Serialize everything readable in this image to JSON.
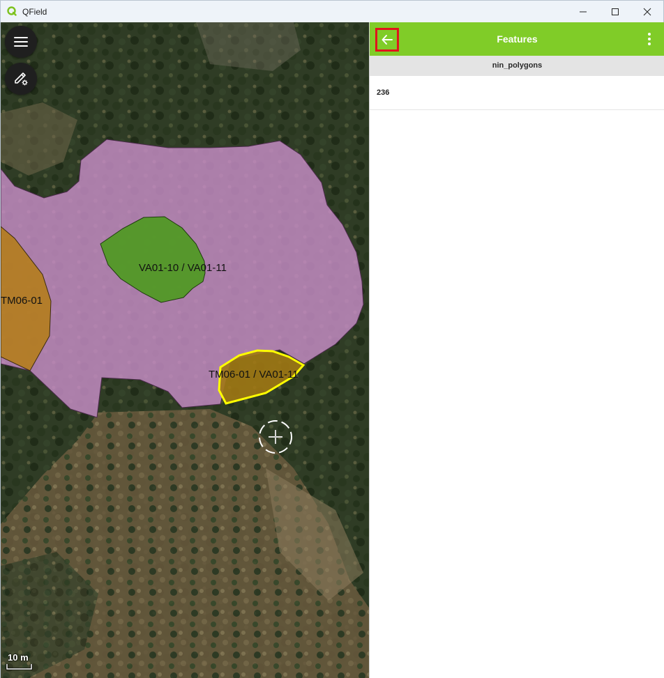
{
  "window": {
    "title": "QField",
    "controls": [
      "minimize",
      "maximize",
      "close"
    ]
  },
  "map": {
    "labels": [
      {
        "text": "VA01-10 / VA01-11"
      },
      {
        "text": "TM06-01"
      },
      {
        "text": "TM06-01 / VA01-11"
      }
    ],
    "scale": "10 m",
    "colors": {
      "large_polygon": "#c88ec8",
      "green_polygon": "#4c9a1e",
      "brown_polygon": "#b47d14",
      "selected_outline": "#ffff00"
    }
  },
  "buttons": {
    "main_menu_icon": "hamburger-menu-icon",
    "digitize_icon": "pen-settings-icon"
  },
  "panel": {
    "title": "Features",
    "back_icon": "arrow-left-icon",
    "menu_icon": "more-vertical-icon",
    "layer_name": "nin_polygons",
    "features": [
      "236"
    ],
    "accent": "#80cc28"
  }
}
